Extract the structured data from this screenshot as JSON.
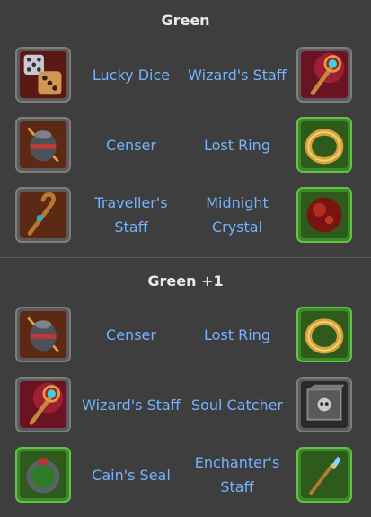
{
  "sections": [
    {
      "title": "Green",
      "rows": [
        {
          "left": {
            "name": "Lucky Dice",
            "icon": "dice-icon",
            "frame": "red"
          },
          "right": {
            "name": "Wizard's Staff",
            "icon": "staff-icon",
            "frame": "red"
          }
        },
        {
          "left": {
            "name": "Censer",
            "icon": "censer-icon",
            "frame": "red"
          },
          "right": {
            "name": "Lost Ring",
            "icon": "ring-icon",
            "frame": "green"
          }
        },
        {
          "left": {
            "name": "Traveller's Staff",
            "icon": "crook-icon",
            "frame": "red"
          },
          "right": {
            "name": "Midnight Crystal",
            "icon": "crystal-orb-icon",
            "frame": "green"
          }
        }
      ]
    },
    {
      "title": "Green +1",
      "rows": [
        {
          "left": {
            "name": "Censer",
            "icon": "censer-icon",
            "frame": "red"
          },
          "right": {
            "name": "Lost Ring",
            "icon": "ring-icon",
            "frame": "green"
          }
        },
        {
          "left": {
            "name": "Wizard's Staff",
            "icon": "staff-icon",
            "frame": "red"
          },
          "right": {
            "name": "Soul Catcher",
            "icon": "skull-box-icon",
            "frame": "gray"
          }
        },
        {
          "left": {
            "name": "Cain's Seal",
            "icon": "seal-icon",
            "frame": "green"
          },
          "right": {
            "name": "Enchanter's Staff",
            "icon": "enchanter-staff-icon",
            "frame": "green"
          }
        }
      ]
    }
  ]
}
